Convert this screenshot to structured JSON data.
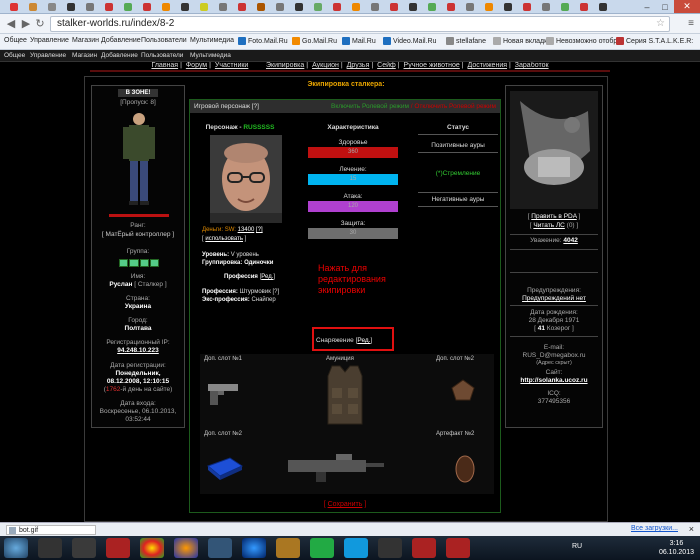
{
  "browser": {
    "url": "stalker-worlds.ru/index/8-2",
    "back_icon": "arrow-left-icon",
    "forward_icon": "arrow-right-icon",
    "reload_icon": "reload-icon",
    "window_controls": [
      "–",
      "□",
      "✕"
    ]
  },
  "bookmarks": [
    "Общее",
    "Управление",
    "Магазин",
    "Добавление",
    "Пользователи",
    "Мультимедиа",
    "Foto.Mail.Ru",
    "Go.Mail.Ru",
    "Mail.Ru",
    "Video.Mail.Ru",
    "stellafane",
    "Новая вкладка",
    "Невозможно отобр…",
    "Серия S.T.A.L.K.E.R:"
  ],
  "site_nav": [
    "Главная",
    "Форум",
    "Участники",
    "Экипировка",
    "Аукцион",
    "Друзья",
    "Сейф",
    "Ручное животное",
    "Достижения",
    "Заработок"
  ],
  "page_title": "Экипировка сталкера:",
  "left": {
    "zone": "В ЗОНЕ!",
    "passes": "[Пропуск: 8]",
    "rank_label": "Ранг:",
    "rank": "[ МатЁрый контроллер ]",
    "group_label": "Группа:",
    "name_label": "Имя:",
    "name": "Руслан",
    "role": "[ Сталкер ]",
    "country_label": "Страна:",
    "country": "Украина",
    "city_label": "Город:",
    "city": "Полтава",
    "ip_label": "Регистрационный IP:",
    "ip": "94.248.10.223",
    "reg_label": "Дата регистрации:",
    "reg_day": "Понедельник,",
    "reg_date": "08.12.2008, 12:10:15",
    "days_count": "1762",
    "days_text": "-й день на сайте)",
    "login_label": "Дата входа:",
    "login_date": "Воскресенье, 06.10.2013,",
    "login_time": "03:52:44"
  },
  "center": {
    "header_title": "Игровой персонаж [?]",
    "rp_on": "Включить Ролевой режим",
    "rp_off": "Отключить Ролевой режим",
    "char_label": "Персонаж - ",
    "char_name": "RUSSSSS",
    "money_label": "Деньги: ",
    "sw": "SW: ",
    "money": "13400",
    "money_help": "[?]",
    "use_link": "использовать",
    "level_label": "Уровень:",
    "level": "V уровень",
    "grouping_label": "Группировка:",
    "grouping": "Одиночки",
    "profession_label": "Профессия",
    "edit_link": "Ред.",
    "profession_line_label": "Профессия:",
    "profession": "Штурмовик [?]",
    "exprof_label": "Экс-профессия:",
    "exprof": "Снайпер",
    "stats_title": "Характеристика",
    "stats": [
      {
        "label": "Здоровье",
        "value": "360",
        "color": "#c01010"
      },
      {
        "label": "Лечение:",
        "value": "15",
        "color": "#00b4f0"
      },
      {
        "label": "Атака:",
        "value": "120",
        "color": "#b040d0"
      },
      {
        "label": "Защита:",
        "value": "30",
        "color": "#6e6e6e"
      }
    ],
    "status_title": "Статус",
    "pos_auras": "Позитивные ауры",
    "aura": "(*)Стремление",
    "neg_auras": "Негативные ауры",
    "annotation": "Нажать для редактирования экипировки",
    "gear_label": "Снаряжение",
    "gear_edit": "Ред.",
    "slot1": "Доп. слот №1",
    "ammo": "Амуниция",
    "slot2": "Доп. слот №2",
    "slot3": "Доп. слот №2",
    "artifact": "Артефакт №2",
    "save": "Сохранить"
  },
  "right": {
    "edit_pda": "Править в PDA",
    "read_pm": "Читать ЛС",
    "pm_count": "(0)",
    "respect_label": "Уважение:",
    "respect": "4042",
    "warn_label": "Предупреждения:",
    "warn": "Предупреждений нет",
    "birth_label": "Дата рождения:",
    "birth": "28 Декабря 1971",
    "age": "41",
    "zodiac": "Козерог",
    "email_label": "E-mail:",
    "email": "RUS_D@megabox.ru",
    "email_note": "(Адрес скрыт)",
    "site_label": "Сайт:",
    "site": "http://solanka.ucoz.ru",
    "icq_label": "ICQ:",
    "icq": "377495356"
  },
  "download": {
    "file": "bot.gif",
    "all": "Все загрузки..."
  },
  "taskbar": {
    "lang": "RU",
    "time": "3:16",
    "date": "06.10.2013"
  }
}
